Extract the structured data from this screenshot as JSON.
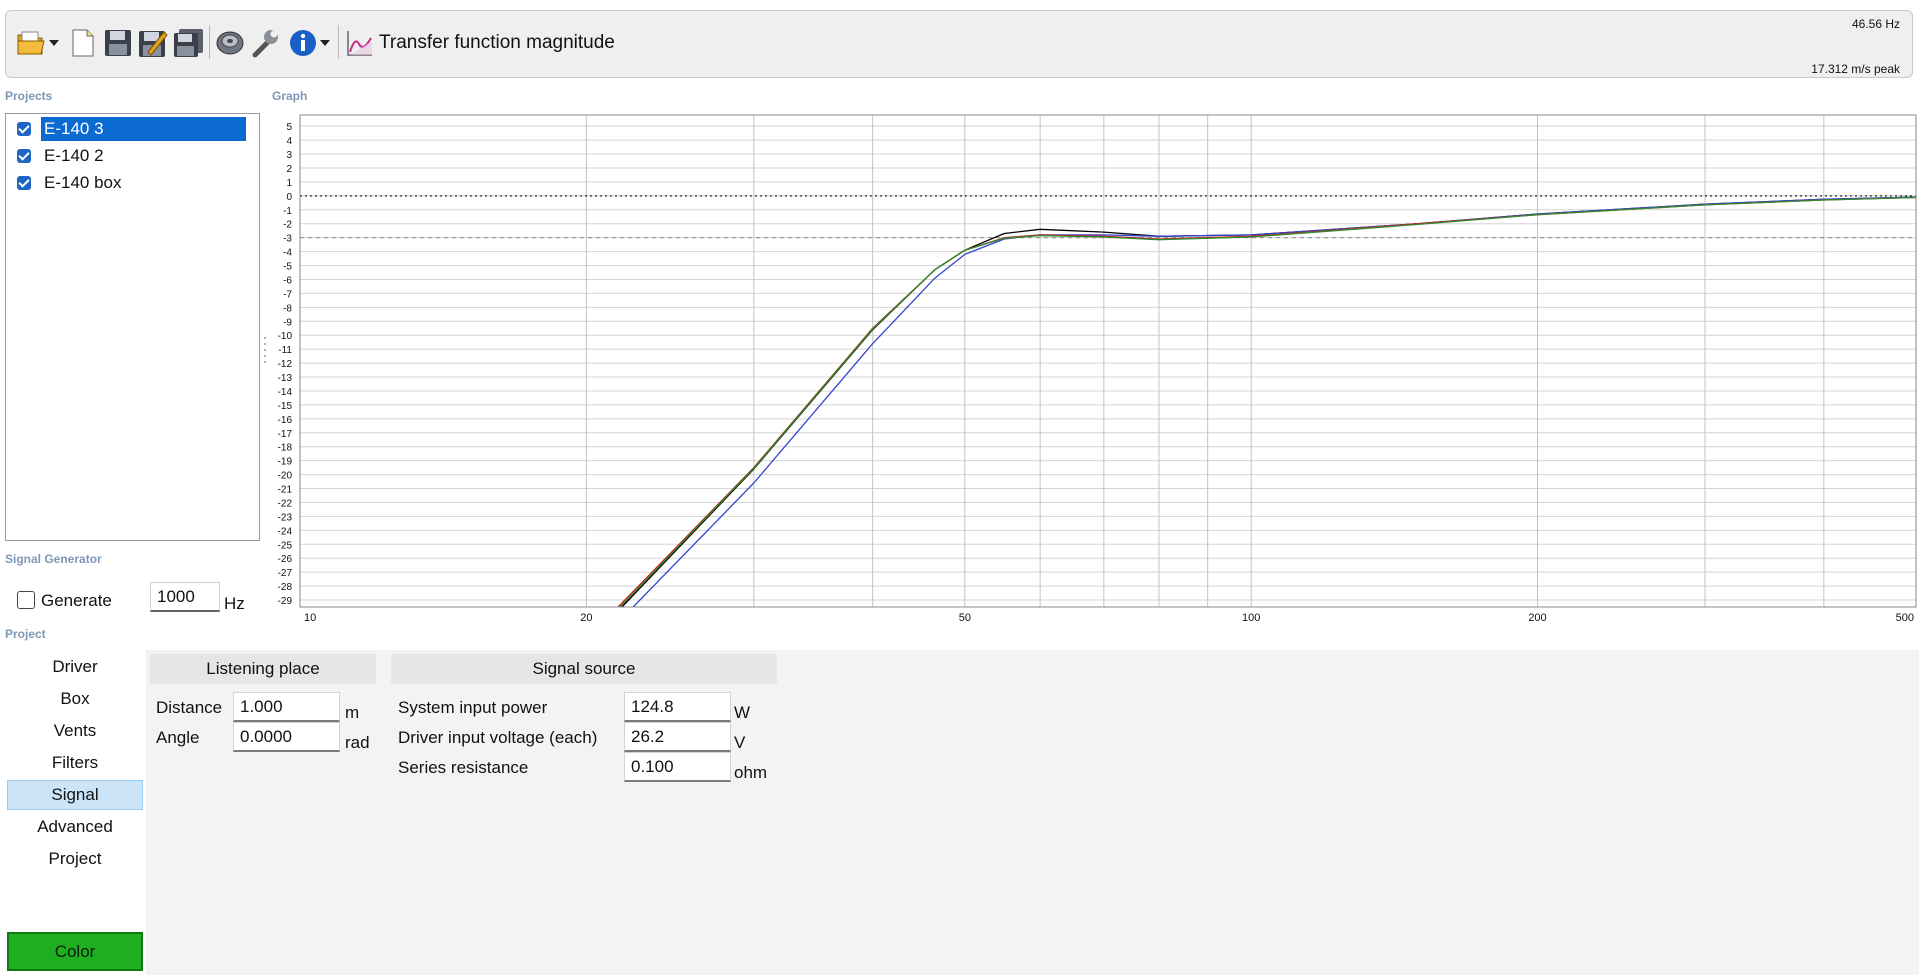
{
  "toolbar": {
    "title": "Transfer function magnitude",
    "status_frequency": "46.56 Hz",
    "status_peak": "17.312 m/s peak",
    "icons": [
      "open-folder-icon",
      "new-document-icon",
      "save-icon",
      "save-as-icon",
      "save-all-icon",
      "speaker-icon",
      "wrench-icon",
      "info-icon",
      "graph-icon"
    ]
  },
  "sections": {
    "projects": "Projects",
    "graph": "Graph",
    "signal_generator": "Signal Generator",
    "project": "Project"
  },
  "projects": [
    {
      "name": "E-140 3",
      "checked": true,
      "selected": true
    },
    {
      "name": "E-140 2",
      "checked": true,
      "selected": false
    },
    {
      "name": "E-140 box",
      "checked": true,
      "selected": false
    }
  ],
  "signal_generator": {
    "generate_label": "Generate",
    "generate_checked": false,
    "frequency": "1000",
    "unit": "Hz"
  },
  "nav": {
    "items": [
      "Driver",
      "Box",
      "Vents",
      "Filters",
      "Signal",
      "Advanced",
      "Project"
    ],
    "active": "Signal",
    "color_button": "Color",
    "color_button_color": "#1fae1f"
  },
  "listening_place": {
    "header": "Listening place",
    "distance_label": "Distance",
    "distance_value": "1.000",
    "distance_unit": "m",
    "angle_label": "Angle",
    "angle_value": "0.0000",
    "angle_unit": "rad"
  },
  "signal_source": {
    "header": "Signal source",
    "power_label": "System input power",
    "power_value": "124.8",
    "power_unit": "W",
    "voltage_label": "Driver input voltage (each)",
    "voltage_value": "26.2",
    "voltage_unit": "V",
    "resistance_label": "Series resistance",
    "resistance_value": "0.100",
    "resistance_unit": "ohm"
  },
  "chart_data": {
    "type": "line",
    "x_scale": "log",
    "xlim": [
      10,
      500
    ],
    "ylim": [
      -29.5,
      5.8
    ],
    "x_tick_labels": [
      10,
      20,
      50,
      100,
      200,
      500
    ],
    "x_gridlines": [
      10,
      20,
      30,
      40,
      50,
      60,
      70,
      80,
      90,
      100,
      200,
      300,
      400,
      500
    ],
    "y_ticks": [
      5,
      4,
      3,
      2,
      1,
      0,
      -1,
      -2,
      -3,
      -4,
      -5,
      -6,
      -7,
      -8,
      -9,
      -10,
      -11,
      -12,
      -13,
      -14,
      -15,
      -16,
      -17,
      -18,
      -19,
      -20,
      -21,
      -22,
      -23,
      -24,
      -25,
      -26,
      -27,
      -28,
      -29
    ],
    "reference_lines": [
      {
        "y": 0,
        "style": "dotted",
        "color": "#222222"
      },
      {
        "y": -3,
        "style": "dashed",
        "color": "#999999"
      }
    ],
    "grid": true,
    "series": [
      {
        "color": "#000000",
        "points": [
          [
            21.8,
            -29.5
          ],
          [
            30,
            -19.6
          ],
          [
            40,
            -9.6
          ],
          [
            46.5,
            -5.3
          ],
          [
            50,
            -3.9
          ],
          [
            55,
            -2.7
          ],
          [
            60,
            -2.4
          ],
          [
            70,
            -2.6
          ],
          [
            80,
            -2.9
          ],
          [
            100,
            -2.8
          ],
          [
            150,
            -2.0
          ],
          [
            200,
            -1.3
          ],
          [
            300,
            -0.6
          ],
          [
            400,
            -0.25
          ],
          [
            500,
            -0.1
          ]
        ]
      },
      {
        "color": "#3344cc",
        "points": [
          [
            22.4,
            -29.5
          ],
          [
            30,
            -20.6
          ],
          [
            40,
            -10.6
          ],
          [
            46.5,
            -5.9
          ],
          [
            50,
            -4.2
          ],
          [
            55,
            -3.1
          ],
          [
            60,
            -2.8
          ],
          [
            70,
            -2.8
          ],
          [
            80,
            -2.9
          ],
          [
            100,
            -2.8
          ],
          [
            150,
            -2.0
          ],
          [
            200,
            -1.3
          ],
          [
            300,
            -0.6
          ],
          [
            400,
            -0.25
          ],
          [
            500,
            -0.1
          ]
        ]
      },
      {
        "color": "#cc2222",
        "points": [
          [
            21.6,
            -29.5
          ],
          [
            30,
            -19.5
          ],
          [
            40,
            -9.5
          ],
          [
            46.5,
            -5.3
          ],
          [
            50,
            -3.9
          ],
          [
            55,
            -3.0
          ],
          [
            60,
            -2.8
          ],
          [
            70,
            -2.9
          ],
          [
            80,
            -3.1
          ],
          [
            100,
            -2.9
          ],
          [
            150,
            -2.0
          ],
          [
            200,
            -1.35
          ],
          [
            300,
            -0.65
          ],
          [
            400,
            -0.3
          ],
          [
            500,
            -0.12
          ]
        ]
      },
      {
        "color": "#2e8b2e",
        "points": [
          [
            21.7,
            -29.5
          ],
          [
            30,
            -19.55
          ],
          [
            40,
            -9.55
          ],
          [
            46.5,
            -5.3
          ],
          [
            50,
            -3.9
          ],
          [
            55,
            -3.05
          ],
          [
            60,
            -2.85
          ],
          [
            70,
            -2.95
          ],
          [
            80,
            -3.15
          ],
          [
            100,
            -2.95
          ],
          [
            150,
            -2.05
          ],
          [
            200,
            -1.35
          ],
          [
            300,
            -0.65
          ],
          [
            400,
            -0.3
          ],
          [
            500,
            -0.12
          ]
        ]
      }
    ]
  }
}
